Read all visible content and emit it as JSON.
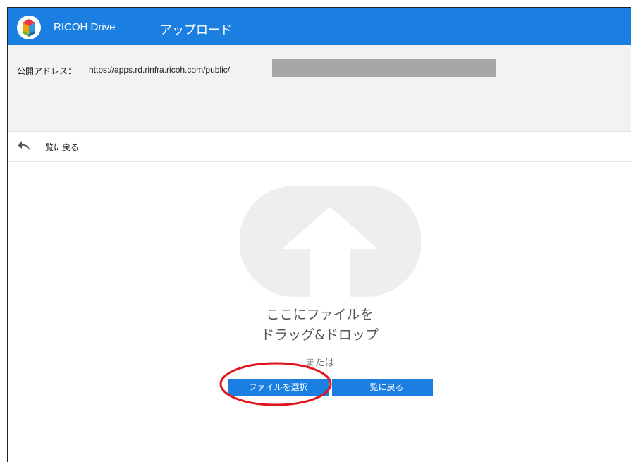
{
  "header": {
    "brand": "RICOH Drive",
    "title": "アップロード",
    "background_color": "#1a7fe0"
  },
  "address": {
    "label": "公開アドレス：",
    "url": "https://apps.rd.rinfra.ricoh.com/public/"
  },
  "nav": {
    "back_label": "一覧に戻る"
  },
  "dropzone": {
    "line1": "ここにファイルを",
    "line2": "ドラッグ&ドロップ",
    "or": "または"
  },
  "buttons": {
    "select_file": "ファイルを選択",
    "back_to_list": "一覧に戻る",
    "color": "#1a7fe0"
  },
  "annotation": {
    "highlight_color": "#e0141a"
  }
}
